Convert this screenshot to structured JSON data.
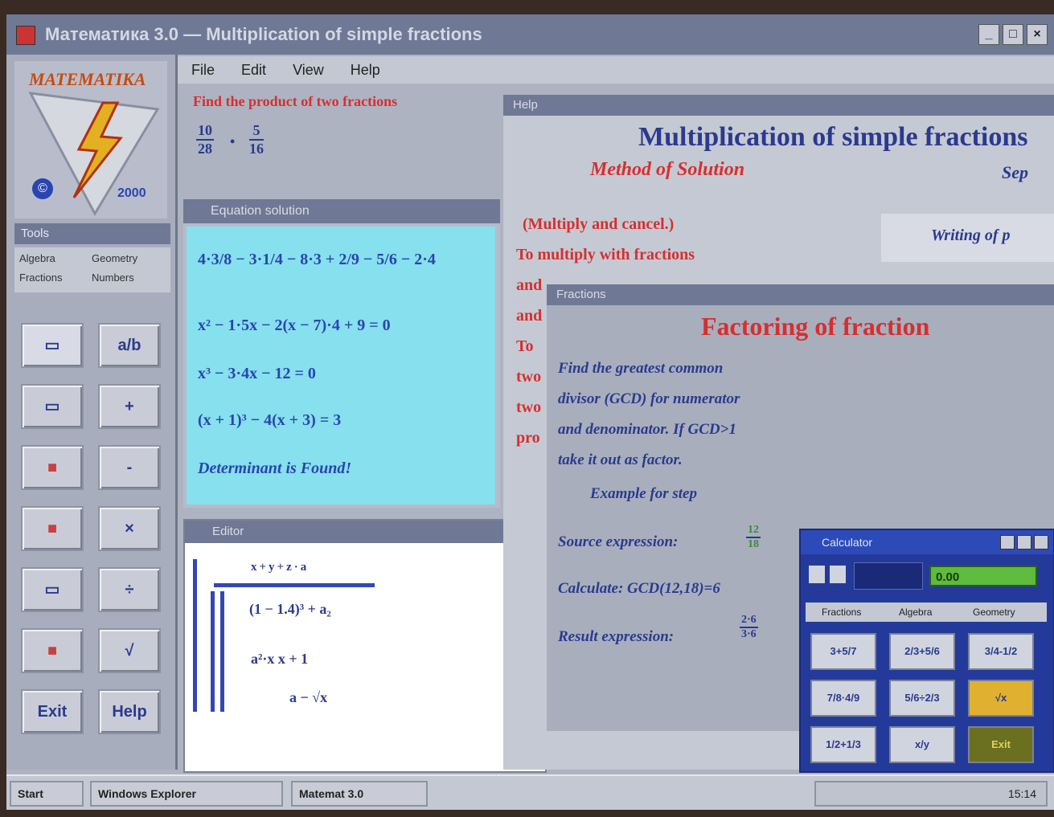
{
  "window": {
    "title": "Математика 3.0 — Multiplication of simple fractions"
  },
  "menu": [
    "File",
    "Edit",
    "View",
    "Help"
  ],
  "logo": {
    "brand": "MATEMATIKA",
    "copyright": "©",
    "label": "2000"
  },
  "left_panel": {
    "title": "Tools",
    "tabs": [
      "Algebra",
      "Geometry",
      "Fractions",
      "Numbers"
    ],
    "buttons": [
      "a/b",
      "+",
      "-",
      "×",
      "÷",
      "√",
      "Exit",
      "Help"
    ]
  },
  "task": {
    "text": "Find the product of two fractions",
    "fraction1": {
      "num": "10",
      "den": "28"
    },
    "op": "•",
    "fraction2": {
      "num": "5",
      "den": "16"
    }
  },
  "cyan_window": {
    "title": "Equation solution",
    "lines": [
      "4·3/8 − 3·1/4 − 8·3 + 2/9 − 5/6 − 2·4",
      "x² − 1·5x − 2(x − 7)·4 + 9 = 0",
      "x³ − 3·4x − 12 = 0",
      "(x + 1)³ − 4(x + 3) = 3",
      "Determinant is Found!"
    ]
  },
  "editor_window": {
    "title": "Editor",
    "top": "x+y+z·a",
    "expr1": "(1 − 1.4)³ + a₂",
    "expr2": "a²·x  x + 1",
    "expr3": "a − √x"
  },
  "doc_window": {
    "title": "Help",
    "heading": "Multiplication of simple fractions",
    "method": "Method of Solution",
    "sep": "Sep",
    "lines": [
      "(Multiply and cancel.)",
      "To multiply with fractions",
      "and",
      "and",
      "To",
      "two",
      "two",
      "pro"
    ],
    "writing": "Writing of p"
  },
  "fraction_window": {
    "title": "Fractions",
    "heading": "Factoring of fraction",
    "lines": [
      "Find the greatest common",
      "divisor (GCD) for numerator",
      "and denominator. If GCD>1",
      "take it out as factor.",
      "Example for step"
    ],
    "source_label": "Source expression:",
    "calc_label": "Calculate: GCD(12,18)=6",
    "result_label": "Result expression:",
    "src_num": "12",
    "src_den": "18",
    "res_num": "2·6",
    "res_den": "3·6"
  },
  "calculator": {
    "title": "Calculator",
    "display": "0.00",
    "tabs": [
      "Fractions",
      "Algebra",
      "Geometry"
    ],
    "buttons": [
      "3+5/7",
      "2/3+5/6",
      "3/4-1/2",
      "7/8·4/9",
      "5/6÷2/3",
      "√x",
      "1/2+1/3",
      "x/y",
      "Exit"
    ]
  },
  "taskbar": {
    "start": "Start",
    "app1": "Windows Explorer",
    "app2": "Matemat 3.0",
    "clock": "15:14"
  }
}
